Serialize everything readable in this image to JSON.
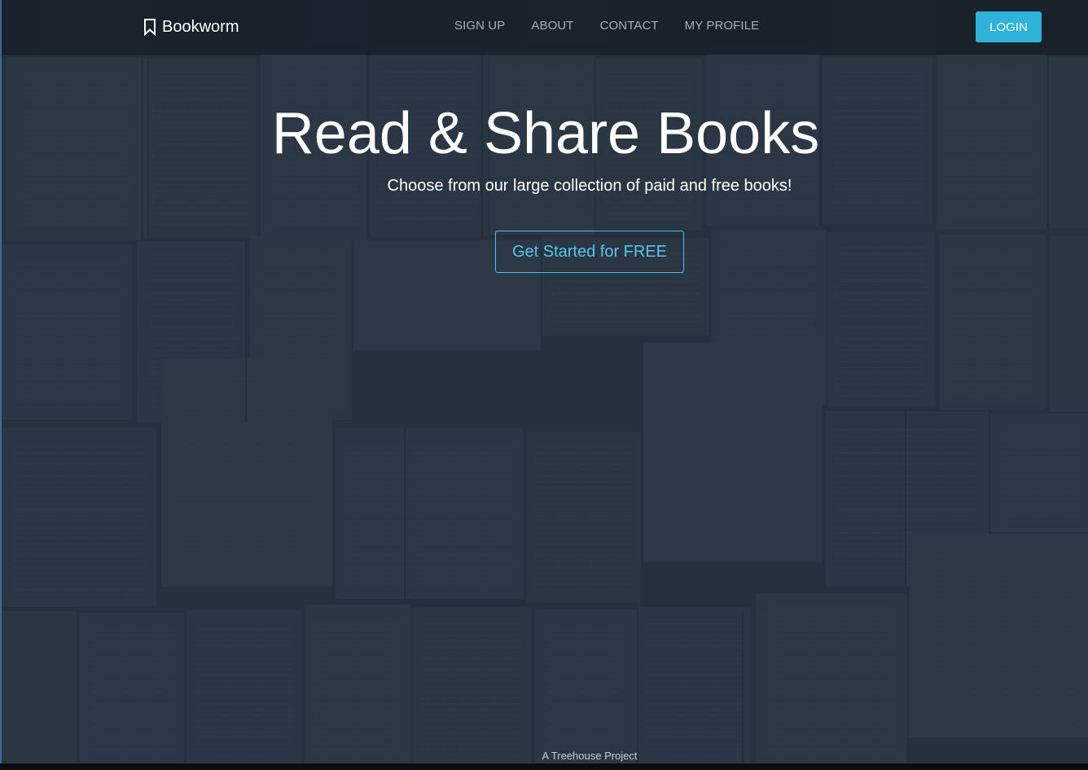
{
  "brand": {
    "name": "Bookworm",
    "icon": "bookmark-icon"
  },
  "nav": {
    "links": [
      {
        "label": "SIGN UP"
      },
      {
        "label": "ABOUT"
      },
      {
        "label": "CONTACT"
      },
      {
        "label": "MY PROFILE"
      }
    ],
    "login_label": "LOGIN"
  },
  "hero": {
    "headline": "Read & Share Books",
    "subheadline": "Choose from our large collection of paid and free books!",
    "cta_label": "Get Started for FREE"
  },
  "footer": {
    "text": "A Treehouse Project"
  },
  "colors": {
    "accent": "#2fb2da",
    "cta_text": "#56c5ea",
    "navbar_bg": "#161e27",
    "hero_tint": "#2a3744",
    "nav_link": "#a8b0b8"
  }
}
